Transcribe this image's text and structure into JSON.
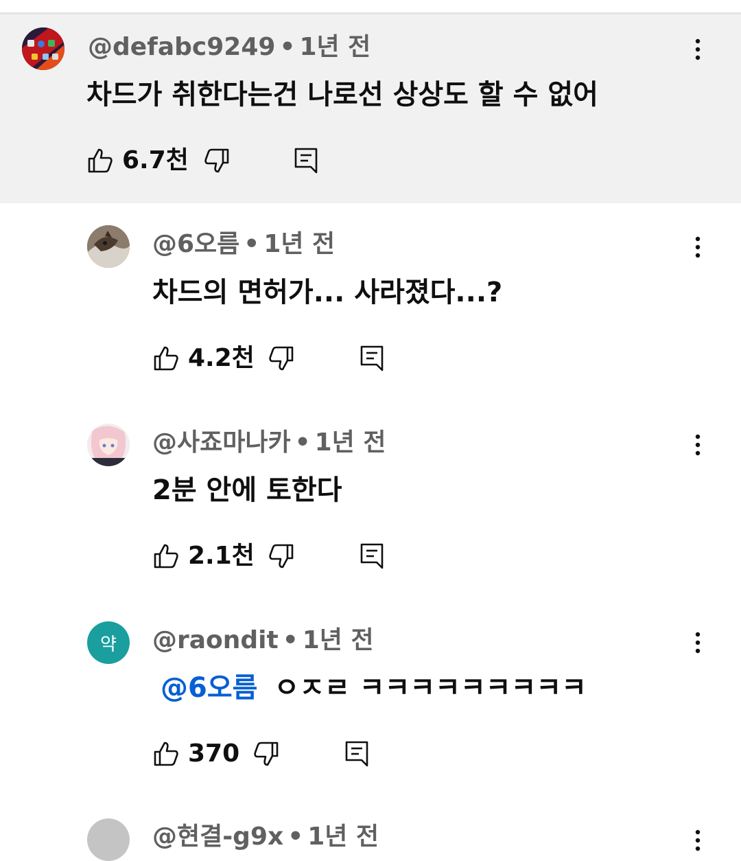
{
  "comments": [
    {
      "handle": "@defabc9249",
      "time": "1년 전",
      "text": "차드가 취한다는건 나로선 상상도 할 수 없어",
      "likes": "6.7천",
      "highlighted": true,
      "is_reply": false
    },
    {
      "handle": "@6오름",
      "time": "1년 전",
      "text": "차드의 면허가... 사라졌다...?",
      "likes": "4.2천",
      "is_reply": true
    },
    {
      "handle": "@사죠마나카",
      "time": "1년 전",
      "text": "2분 안에 토한다",
      "likes": "2.1천",
      "is_reply": true
    },
    {
      "handle": "@raondit",
      "time": "1년 전",
      "mention": "@6오름",
      "text": "ㅇㅈㄹ ㅋㅋㅋㅋㅋㅋㅋㅋㅋ",
      "likes": "370",
      "avatar_letter": "약",
      "avatar_color": "#1a9e9e",
      "is_reply": true
    },
    {
      "handle": "@현결-g9x",
      "time": "1년 전",
      "is_reply": true
    }
  ],
  "separator": "•",
  "colors": {
    "highlight_bg": "#f1f1f1",
    "meta_text": "#606060",
    "mention": "#065fd4"
  },
  "icons": [
    "like-icon",
    "dislike-icon",
    "reply-icon",
    "more-options-icon"
  ]
}
